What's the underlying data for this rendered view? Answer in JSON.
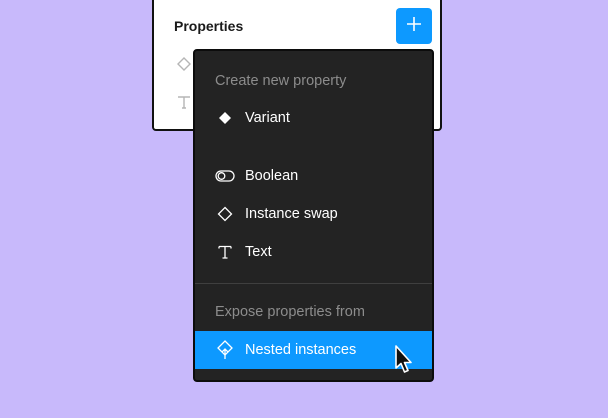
{
  "panel": {
    "title": "Properties"
  },
  "menu": {
    "create_header": "Create new property",
    "create_items": [
      {
        "label": "Variant",
        "icon": "diamond-filled-icon"
      },
      {
        "label": "Boolean",
        "icon": "toggle-icon"
      },
      {
        "label": "Instance swap",
        "icon": "diamond-outline-icon"
      },
      {
        "label": "Text",
        "icon": "text-icon"
      }
    ],
    "expose_header": "Expose properties from",
    "expose_items": [
      {
        "label": "Nested instances",
        "icon": "nested-instance-icon",
        "highlighted": true
      }
    ]
  },
  "colors": {
    "background": "#c8b9fb",
    "accent": "#0d99ff",
    "menu_bg": "#232323"
  }
}
